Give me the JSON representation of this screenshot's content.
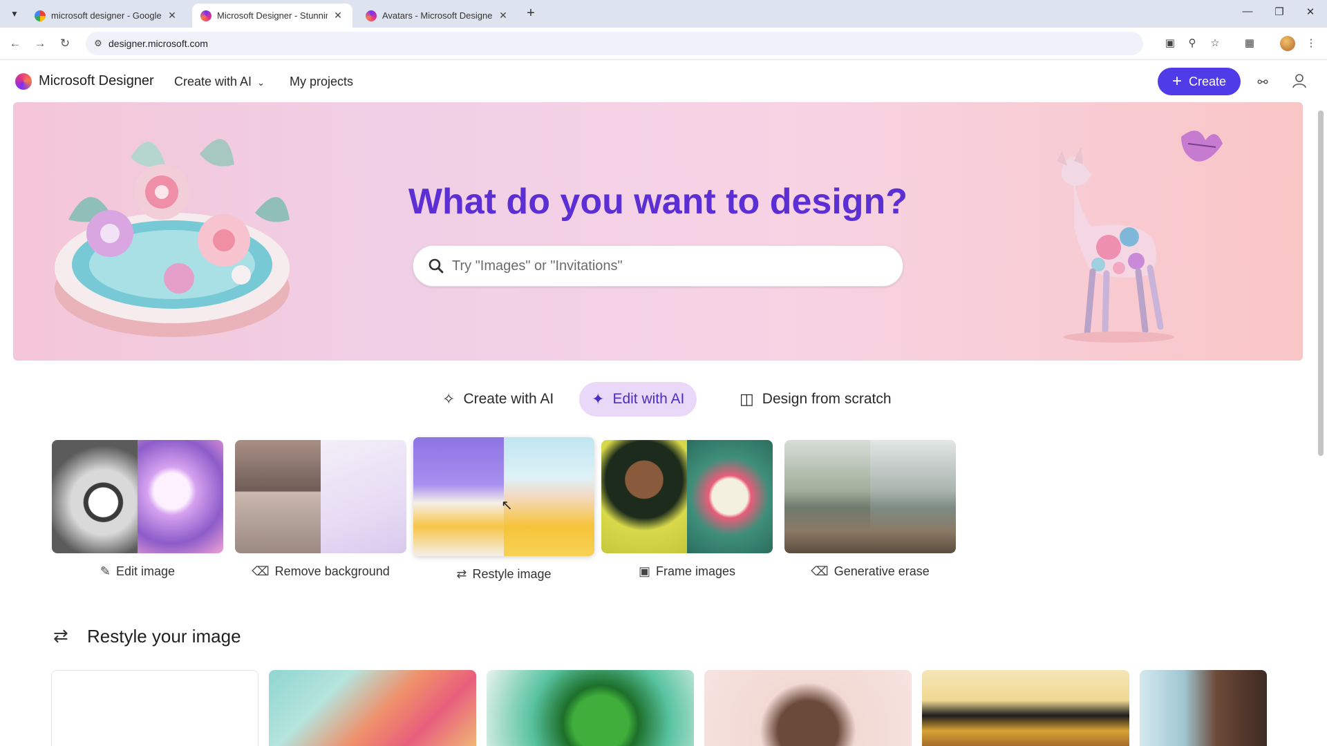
{
  "browser": {
    "tabs": [
      {
        "title": "microsoft designer - Google Se",
        "favicon": "google-icon",
        "active": false
      },
      {
        "title": "Microsoft Designer - Stunning",
        "favicon": "designer-icon",
        "active": true
      },
      {
        "title": "Avatars - Microsoft Designer",
        "favicon": "designer-icon",
        "active": false
      }
    ],
    "url": "designer.microsoft.com"
  },
  "header": {
    "brand": "Microsoft Designer",
    "nav_create": "Create with AI",
    "nav_projects": "My projects",
    "create_button": "Create"
  },
  "hero": {
    "title": "What do you want to design?",
    "search_placeholder": "Try \"Images\" or \"Invitations\""
  },
  "mode_tabs": [
    {
      "label": "Create with AI",
      "icon": "sparkle-icon",
      "active": false
    },
    {
      "label": "Edit with AI",
      "icon": "magic-wand-icon",
      "active": true
    },
    {
      "label": "Design from scratch",
      "icon": "design-icon",
      "active": false
    }
  ],
  "features": [
    {
      "label": "Edit image",
      "icon": "edit-image-icon"
    },
    {
      "label": "Remove background",
      "icon": "eraser-icon"
    },
    {
      "label": "Restyle image",
      "icon": "swap-icon"
    },
    {
      "label": "Frame images",
      "icon": "frame-icon"
    },
    {
      "label": "Generative erase",
      "icon": "eraser-icon"
    }
  ],
  "restyle_section": {
    "title": "Restyle your image",
    "icon": "swap-icon"
  },
  "colors": {
    "accent": "#4f3ce8",
    "hero_title": "#5b2fd3",
    "active_tab_bg": "#ead8f9"
  }
}
